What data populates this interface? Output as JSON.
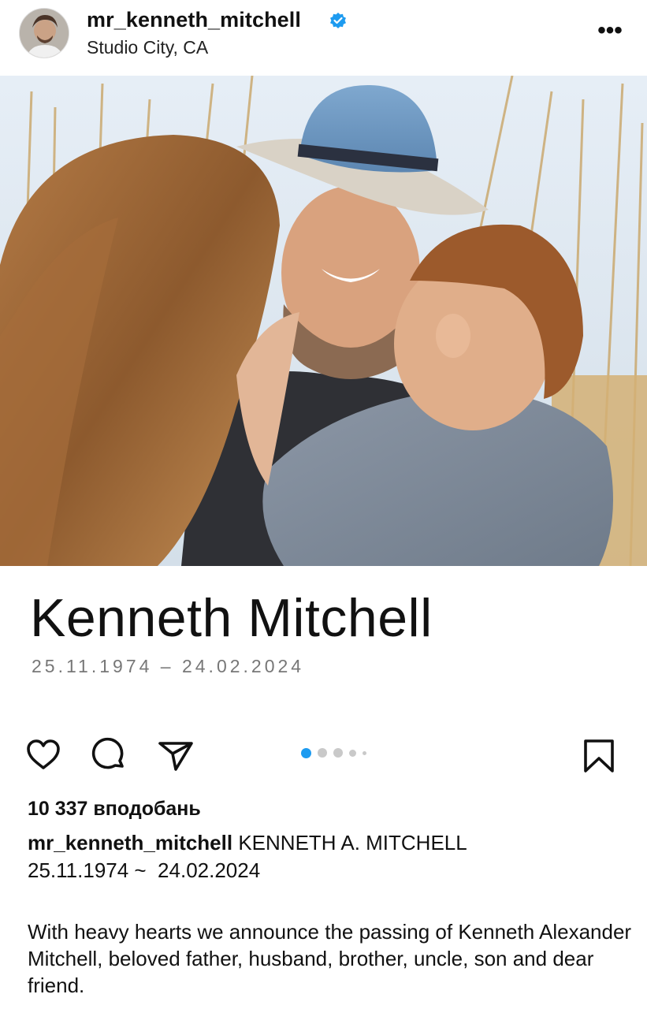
{
  "header": {
    "username": "mr_kenneth_mitchell",
    "location": "Studio City, CA",
    "verified": true,
    "more_label": "•••",
    "avatar_icon": "profile-photo"
  },
  "post": {
    "slide_title": "Kenneth Mitchell",
    "slide_dates": "25.11.1974 – 24.02.2024",
    "carousel": {
      "count": 5,
      "active": 1
    }
  },
  "actions": {
    "like_icon": "heart-icon",
    "comment_icon": "comment-icon",
    "share_icon": "send-icon",
    "save_icon": "bookmark-icon"
  },
  "likes": "10 337 вподобань",
  "caption": {
    "username": "mr_kenneth_mitchell",
    "text_line1": "KENNETH A. MITCHELL",
    "text_line2": "25.11.1974 ~  24.02.2024",
    "body": "With heavy hearts we announce the passing of Kenneth Alexander Mitchell, beloved father, husband, brother, uncle, son and dear friend."
  },
  "colors": {
    "verified_blue": "#1d9bf0",
    "dot_active": "#1d9bf0",
    "dot_inactive": "#c9c9c9",
    "sky": "#dfe8f2",
    "hat_blue": "#6f9bc6",
    "grass": "#c9a567"
  }
}
